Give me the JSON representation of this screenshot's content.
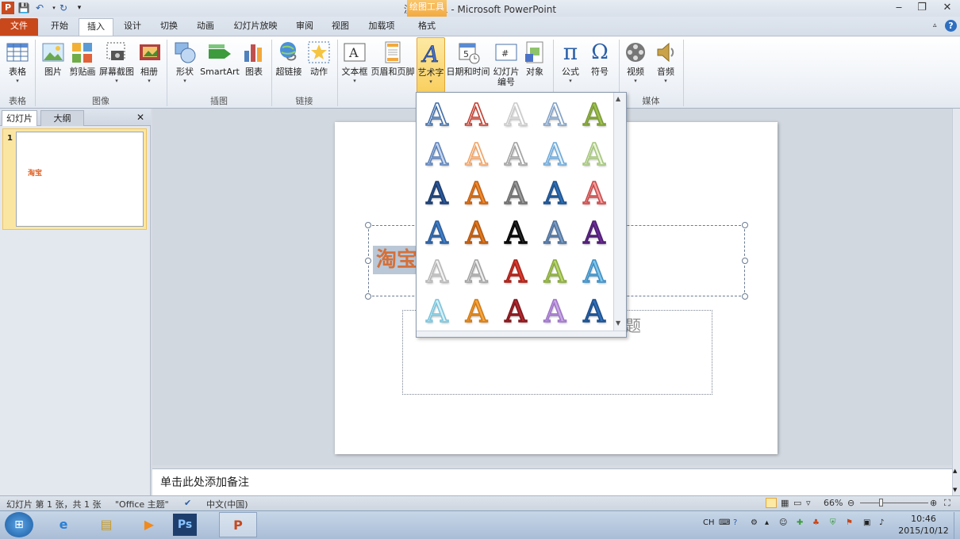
{
  "window": {
    "title": "演示文稿1 - Microsoft PowerPoint",
    "context_tab": "绘图工具"
  },
  "tabs": [
    "文件",
    "开始",
    "插入",
    "设计",
    "切换",
    "动画",
    "幻灯片放映",
    "审阅",
    "视图",
    "加载项",
    "格式"
  ],
  "ribbon": {
    "buttons": [
      "表格",
      "图片",
      "剪贴画",
      "屏幕截图",
      "相册",
      "形状",
      "SmartArt",
      "图表",
      "超链接",
      "动作",
      "文本框",
      "页眉和页脚",
      "艺术字",
      "日期和时间",
      "幻灯片\n编号",
      "对象",
      "公式",
      "符号",
      "视频",
      "音频"
    ],
    "groups": [
      "表格",
      "图像",
      "插图",
      "链接",
      "媒体"
    ]
  },
  "left_pane": {
    "tab_slides": "幻灯片",
    "tab_outline": "大纲",
    "slide_number": "1",
    "thumb_text": "淘宝",
    "close": "✕"
  },
  "slide": {
    "title_text": "淘宝",
    "subtitle_placeholder": "题"
  },
  "notes": {
    "placeholder": "单击此处添加备注"
  },
  "wordart_gallery": {
    "glyph": "A",
    "styles": [
      [
        "#fff",
        "#3d6aa5"
      ],
      [
        "#fff",
        "#c0392b"
      ],
      [
        "#fff",
        "#c9c9c9"
      ],
      [
        "#fff",
        "#7d9ec4"
      ],
      [
        "#9ec04f",
        "#7a9a35"
      ],
      [
        "#c6d6ee",
        "#5b80b8"
      ],
      [
        "#fff",
        "#f0a060"
      ],
      [
        "#fff",
        "#9e9e9e"
      ],
      [
        "#e5f2fb",
        "#6ba7d8"
      ],
      [
        "#eaf4d9",
        "#a3c47a"
      ],
      [
        "#2a5a9c",
        "#1b3a6b"
      ],
      [
        "#f08a2c",
        "#c25f12"
      ],
      [
        "#9a9a9a",
        "#6a6a6a"
      ],
      [
        "#2e6fb6",
        "#1d4f8a"
      ],
      [
        "#f3a0a0",
        "#c84848"
      ],
      [
        "#3f7fc9",
        "#2a5b98"
      ],
      [
        "#e0781c",
        "#b35610"
      ],
      [
        "#222",
        "#000"
      ],
      [
        "#7a9cc4",
        "#4d6f99"
      ],
      [
        "#6a2c96",
        "#4a1c6e"
      ],
      [
        "#f3f3f3",
        "#b5b5b5"
      ],
      [
        "#eee",
        "#a0a0a0"
      ],
      [
        "#d93a2e",
        "#a52018"
      ],
      [
        "#b8d66b",
        "#88a83f"
      ],
      [
        "#7fc6ea",
        "#3d8cc4"
      ],
      [
        "#d7f0f7",
        "#79c3db"
      ],
      [
        "#f6a540",
        "#d07a14"
      ],
      [
        "#b0272d",
        "#7e161b"
      ],
      [
        "#c9a7e3",
        "#9d73c8"
      ],
      [
        "#2f6fb8",
        "#1a4c88"
      ]
    ]
  },
  "status": {
    "slide_info": "幻灯片 第 1 张，共 1 张",
    "theme": "\"Office 主题\"",
    "language": "中文(中国)",
    "zoom": "66%"
  },
  "taskbar": {
    "ime": "CH",
    "time": "10:46",
    "date": "2015/10/12",
    "apps": [
      "IE",
      "Explorer",
      "Media",
      "Ps",
      "PowerPoint"
    ]
  },
  "colors": {
    "file_tab": "#c8481b",
    "context": "#f3a940",
    "accent_title": "#d4703a"
  }
}
